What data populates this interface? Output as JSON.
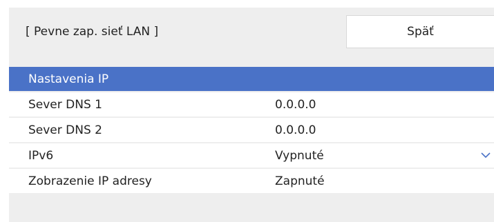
{
  "header": {
    "title": "[ Pevne zap. sieť LAN ]",
    "back_label": "Späť"
  },
  "rows": [
    {
      "label": "Nastavenia IP",
      "value": "",
      "selected": true
    },
    {
      "label": "Sever DNS 1",
      "value": "0.0.0.0",
      "selected": false
    },
    {
      "label": "Sever DNS 2",
      "value": "0.0.0.0",
      "selected": false
    },
    {
      "label": "IPv6",
      "value": "Vypnuté",
      "selected": false,
      "has_dropdown": true,
      "icon": "chevron-down-icon"
    },
    {
      "label": "Zobrazenie IP adresy",
      "value": "Zapnuté",
      "selected": false
    }
  ],
  "colors": {
    "selected_row": "#4a72c7",
    "panel_background": "#eeeeee",
    "chevron": "#4a72c7"
  }
}
